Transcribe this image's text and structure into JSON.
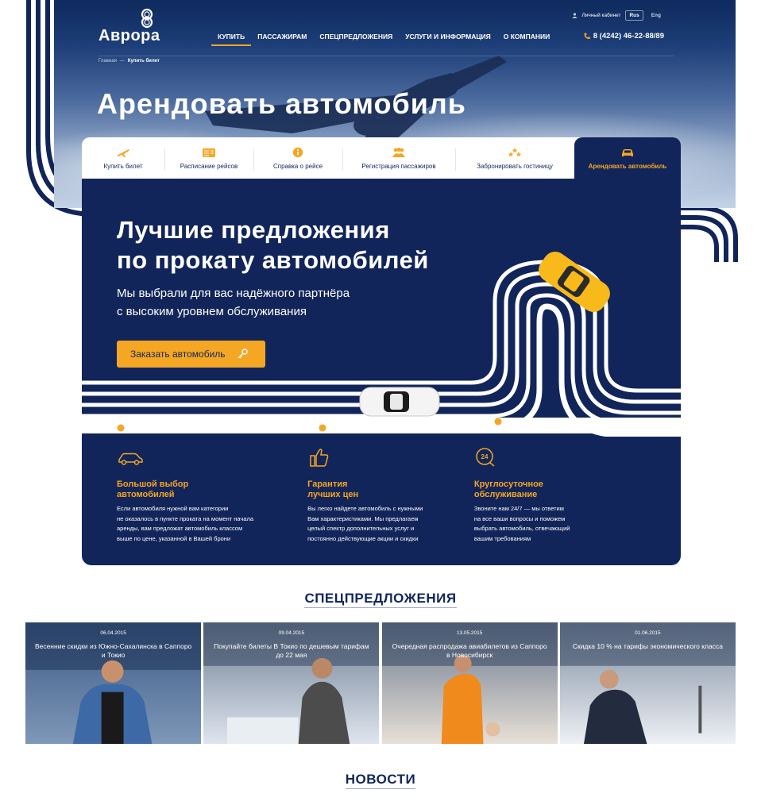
{
  "header": {
    "logo_text": "Аврора",
    "nav": [
      "Купить",
      "Пассажирам",
      "Спецпредложения",
      "Услуги и информация",
      "О компании"
    ],
    "account_label": "Личный кабинет",
    "lang_active": "Rus",
    "lang_other": "Eng",
    "phone": "8 (4242) 46-22-88/89"
  },
  "breadcrumb": {
    "home": "Главная",
    "separator": "—",
    "current": "Купить билет"
  },
  "page_title": "Арендовать автомобиль",
  "tabs": [
    {
      "label": "Купить билет",
      "icon": "plane-icon"
    },
    {
      "label": "Расписание рейсов",
      "icon": "schedule-board-icon"
    },
    {
      "label": "Справка о рейсе",
      "icon": "info-icon"
    },
    {
      "label": "Регистрация пассажиров",
      "icon": "passengers-icon"
    },
    {
      "label": "Забронировать гостиницу",
      "icon": "stars-icon"
    },
    {
      "label": "Арендовать автомобиль",
      "icon": "car-icon",
      "active": true
    }
  ],
  "promo": {
    "heading_line1": "Лучшие предложения",
    "heading_line2": "по прокату автомобилей",
    "sub_line1": "Мы выбрали для вас надёжного партнёра",
    "sub_line2": "с высоким уровнем обслуживания",
    "cta_label": "Заказать автомобиль"
  },
  "features": [
    {
      "icon": "car-outline-icon",
      "title": "Большой выбор\nавтомобилей",
      "text": "Если автомобиля нужной вам категории\nне оказалось в пункте проката на момент начала\nаренды, вам предложат автомобиль классом\nвыше по цене, указанной в Вашей брони"
    },
    {
      "icon": "thumbs-up-icon",
      "title": "Гарантия\nлучших цен",
      "text": "Вы легко найдете автомобиль с нужными\nВам характеристиками. Мы предлагаем\nцелый спектр дополнительных услуг и\nпостоянно действующие акции и скидки"
    },
    {
      "icon": "support-24-icon",
      "title": "Круглосуточное\nобслуживание",
      "text": "Звоните нам 24/7 — мы ответим\nна все ваши вопросы и поможем\nвыбрать автомобиль, отвечающий\nвашим требованиям"
    }
  ],
  "offers_title": "Спецпредложения",
  "offers": [
    {
      "date": "06.04.2015",
      "title": "Весенние скидки из Южно-Сахалинска в Саппоро и Токио"
    },
    {
      "date": "09.04.2015",
      "title": "Покупайте билеты В Токио по дешевым тарифам до 22 мая"
    },
    {
      "date": "13.05.2015",
      "title": "Очередная распродажа авиабилетов из Саппоро в Новосибирск"
    },
    {
      "date": "01.06.2015",
      "title": "Скидка 10 % на тарифы экономического класса"
    }
  ],
  "news_title": "Новости",
  "colors": {
    "navy": "#12255a",
    "accent": "#f5a623",
    "white": "#ffffff"
  }
}
